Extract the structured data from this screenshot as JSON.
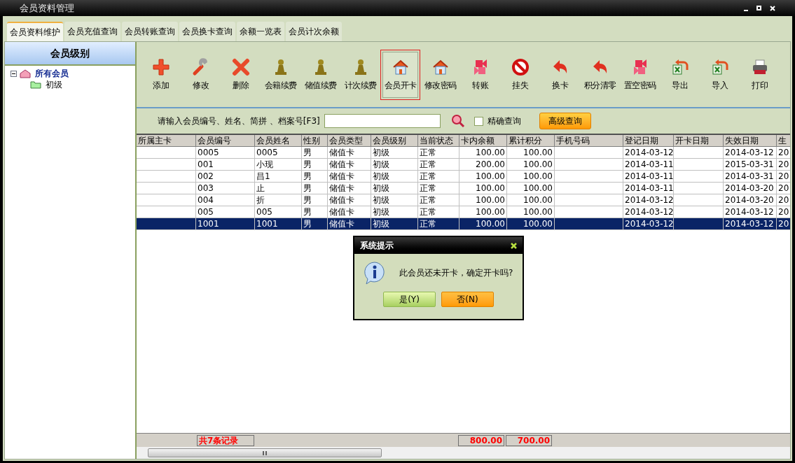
{
  "window": {
    "title": "会员资料管理"
  },
  "tabs": [
    {
      "label": "会员资料维护",
      "selected": true
    },
    {
      "label": "会员充值查询",
      "selected": false
    },
    {
      "label": "会员转账查询",
      "selected": false
    },
    {
      "label": "会员换卡查询",
      "selected": false
    },
    {
      "label": "余额一览表",
      "selected": false
    },
    {
      "label": "会员计次余额",
      "selected": false
    }
  ],
  "sidebar": {
    "title": "会员级别",
    "tree": [
      {
        "label": "所有会员",
        "expanded": true,
        "selected": true,
        "children": [
          {
            "label": "初级",
            "selected": false
          }
        ]
      }
    ]
  },
  "toolbar": [
    {
      "label": "添加",
      "kind": "plus",
      "selected": false
    },
    {
      "label": "修改",
      "kind": "wrench",
      "selected": false
    },
    {
      "label": "删除",
      "kind": "cross",
      "selected": false
    },
    {
      "label": "会籍续费",
      "kind": "pawn",
      "selected": false
    },
    {
      "label": "储值续费",
      "kind": "pawn",
      "selected": false
    },
    {
      "label": "计次续费",
      "kind": "pawn",
      "selected": false
    },
    {
      "label": "会员开卡",
      "kind": "house",
      "selected": true
    },
    {
      "label": "修改密码",
      "kind": "house",
      "selected": false
    },
    {
      "label": "转账",
      "kind": "swap",
      "selected": false
    },
    {
      "label": "挂失",
      "kind": "ban",
      "selected": false
    },
    {
      "label": "换卡",
      "kind": "curve",
      "selected": false
    },
    {
      "label": "积分清零",
      "kind": "curve",
      "selected": false
    },
    {
      "label": "置空密码",
      "kind": "swap",
      "selected": false
    },
    {
      "label": "导出",
      "kind": "sheet",
      "selected": false
    },
    {
      "label": "导入",
      "kind": "sheet",
      "selected": false
    },
    {
      "label": "打印",
      "kind": "printer",
      "selected": false
    }
  ],
  "search": {
    "label": "请输入会员编号、姓名、简拼 、档案号[F3]",
    "exact_match": {
      "label": "精确查询",
      "checked": false
    },
    "advanced_button": "高级查询"
  },
  "table": {
    "columns": [
      "所属主卡",
      "会员编号",
      "会员姓名",
      "性别",
      "会员类型",
      "会员级别",
      "当前状态",
      "卡内余额",
      "累计积分",
      "手机号码",
      "登记日期",
      "开卡日期",
      "失效日期",
      "生"
    ],
    "rows": [
      {
        "selected": false,
        "member_no": "0005",
        "member_name": "0005",
        "gender": "男",
        "member_type": "储值卡",
        "member_level": "初级",
        "status": "正常",
        "balance": "100.00",
        "points": "100.00",
        "register_date": "2014-03-12",
        "expiry_date": "2014-03-12",
        "column_14": "20"
      },
      {
        "selected": false,
        "member_no": "001",
        "member_name": "小现",
        "gender": "男",
        "member_type": "储值卡",
        "member_level": "初级",
        "status": "正常",
        "balance": "200.00",
        "points": "100.00",
        "register_date": "2014-03-11",
        "expiry_date": "2015-03-31",
        "column_14": "20"
      },
      {
        "selected": false,
        "member_no": "002",
        "member_name": "昌1",
        "gender": "男",
        "member_type": "储值卡",
        "member_level": "初级",
        "status": "正常",
        "balance": "100.00",
        "points": "100.00",
        "register_date": "2014-03-11",
        "expiry_date": "2014-03-31",
        "column_14": "20"
      },
      {
        "selected": false,
        "member_no": "003",
        "member_name": "止",
        "gender": "男",
        "member_type": "储值卡",
        "member_level": "初级",
        "status": "正常",
        "balance": "100.00",
        "points": "100.00",
        "register_date": "2014-03-11",
        "expiry_date": "2014-03-20",
        "column_14": "20"
      },
      {
        "selected": false,
        "member_no": "004",
        "member_name": "折",
        "gender": "男",
        "member_type": "储值卡",
        "member_level": "初级",
        "status": "正常",
        "balance": "100.00",
        "points": "100.00",
        "register_date": "2014-03-12",
        "expiry_date": "2014-03-20",
        "column_14": "20"
      },
      {
        "selected": false,
        "member_no": "005",
        "member_name": "005",
        "gender": "男",
        "member_type": "储值卡",
        "member_level": "初级",
        "status": "正常",
        "balance": "100.00",
        "points": "100.00",
        "register_date": "2014-03-12",
        "expiry_date": "2014-03-12",
        "column_14": "20"
      },
      {
        "selected": true,
        "member_no": "1001",
        "member_name": "1001",
        "gender": "男",
        "member_type": "储值卡",
        "member_level": "初级",
        "status": "正常",
        "balance": "100.00",
        "points": "100.00",
        "register_date": "2014-03-12",
        "expiry_date": "2014-03-12",
        "column_14": "20"
      }
    ],
    "footer": {
      "record_count": "共7条记录",
      "balance_total": "800.00",
      "points_total": "700.00"
    }
  },
  "dialog": {
    "title": "系统提示",
    "message": "此会员还未开卡，确定开卡吗?",
    "buttons": [
      {
        "label": "是(Y)",
        "kind": "yes"
      },
      {
        "label": "否(N)",
        "kind": "no"
      }
    ]
  }
}
